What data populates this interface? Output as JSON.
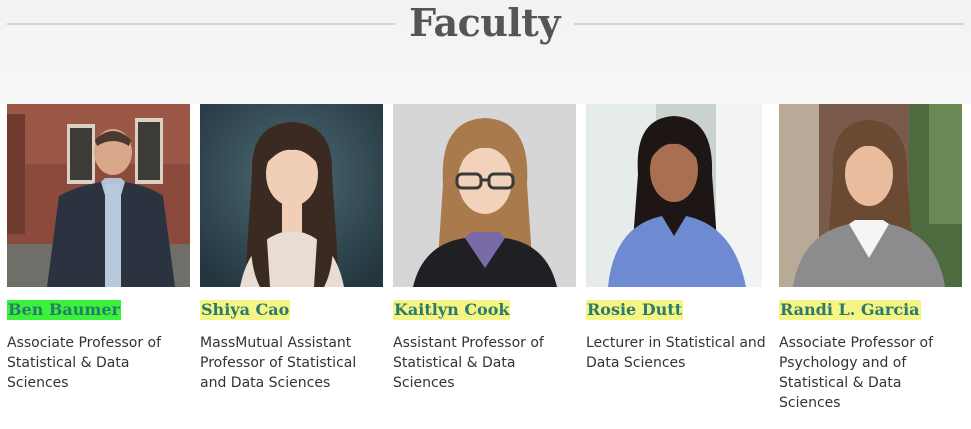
{
  "section": {
    "title": "Faculty"
  },
  "highlight_colors": {
    "green": "#39f239",
    "yellow": "#f5f584"
  },
  "accent": "#2c7a6e",
  "faculty": [
    {
      "name": "Ben Baumer",
      "title": "Associate Professor of Statistical & Data Sciences",
      "highlight": "#39f239"
    },
    {
      "name": "Shiya Cao",
      "title": "MassMutual Assistant Professor of Statistical and Data Sciences",
      "highlight": "#f5f584"
    },
    {
      "name": "Kaitlyn Cook",
      "title": "Assistant Professor of Statistical & Data Sciences",
      "highlight": "#f5f584"
    },
    {
      "name": "Rosie Dutt",
      "title": "Lecturer in Statistical and Data Sciences",
      "highlight": "#f5f584"
    },
    {
      "name": "Randi L. Garcia",
      "title": "Associate Professor of Psychology and of Statistical & Data Sciences",
      "highlight": "#f5f584"
    }
  ]
}
